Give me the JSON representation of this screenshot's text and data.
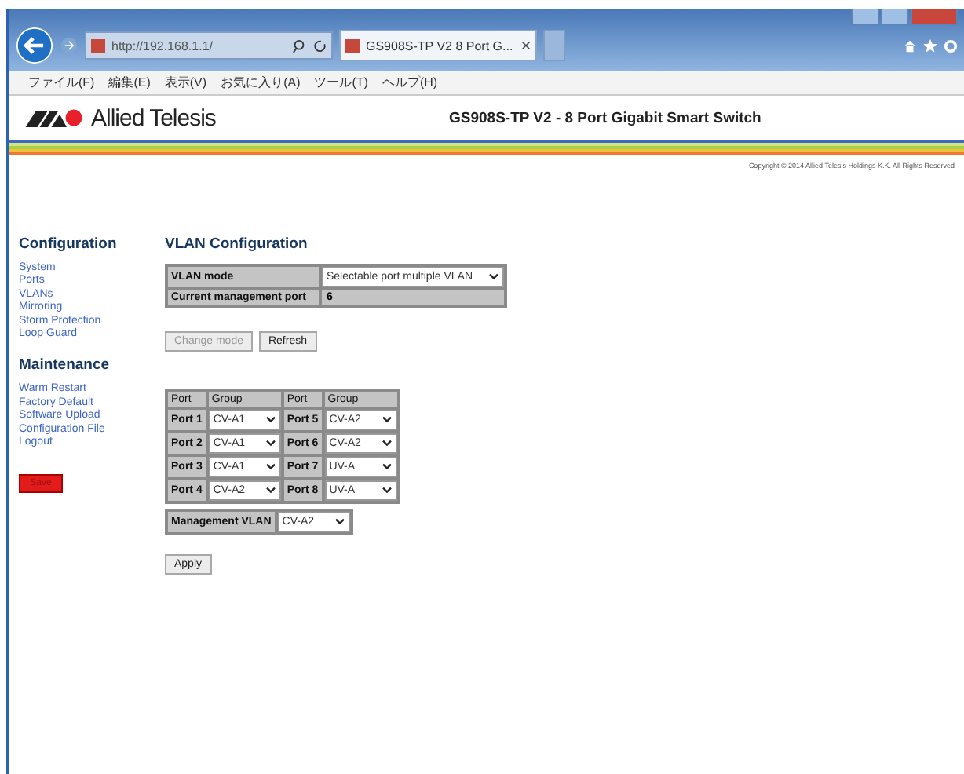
{
  "browser": {
    "address": "http://192.168.1.1/",
    "tab_title": "GS908S-TP V2 8 Port G...",
    "menu": [
      "ファイル(F)",
      "編集(E)",
      "表示(V)",
      "お気に入り(A)",
      "ツール(T)",
      "ヘルプ(H)"
    ]
  },
  "header": {
    "brand": "Allied Telesis",
    "title": "GS908S-TP V2 - 8 Port Gigabit Smart Switch",
    "copyright": "Copyright © 2014 Allied Telesis Holdings K.K. All Rights Reserved"
  },
  "sidebar": {
    "sections": [
      {
        "heading": "Configuration",
        "links": [
          "System",
          "Ports",
          "VLANs",
          "Mirroring",
          "Storm Protection",
          "Loop Guard"
        ]
      },
      {
        "heading": "Maintenance",
        "links": [
          "Warm Restart",
          "Factory Default",
          "Software Upload",
          "Configuration File",
          "Logout"
        ]
      }
    ],
    "save_button": "Save"
  },
  "main": {
    "title": "VLAN Configuration",
    "info_rows": [
      {
        "label": "VLAN mode",
        "value": "Selectable port multiple VLAN",
        "kind": "select"
      },
      {
        "label": "Current management port",
        "value": "6",
        "kind": "text"
      }
    ],
    "buttons": [
      {
        "label": "Change mode",
        "disabled": true
      },
      {
        "label": "Refresh",
        "disabled": false
      }
    ],
    "port_table": {
      "columns": [
        "Port",
        "Group",
        "Port",
        "Group"
      ],
      "rows": [
        [
          "Port 1",
          "CV-A1",
          "Port 5",
          "CV-A2"
        ],
        [
          "Port 2",
          "CV-A1",
          "Port 6",
          "CV-A2"
        ],
        [
          "Port 3",
          "CV-A1",
          "Port 7",
          "UV-A"
        ],
        [
          "Port 4",
          "CV-A2",
          "Port 8",
          "UV-A"
        ]
      ]
    },
    "management_vlan": {
      "label": "Management VLAN",
      "value": "CV-A2"
    },
    "apply_button": "Apply"
  }
}
